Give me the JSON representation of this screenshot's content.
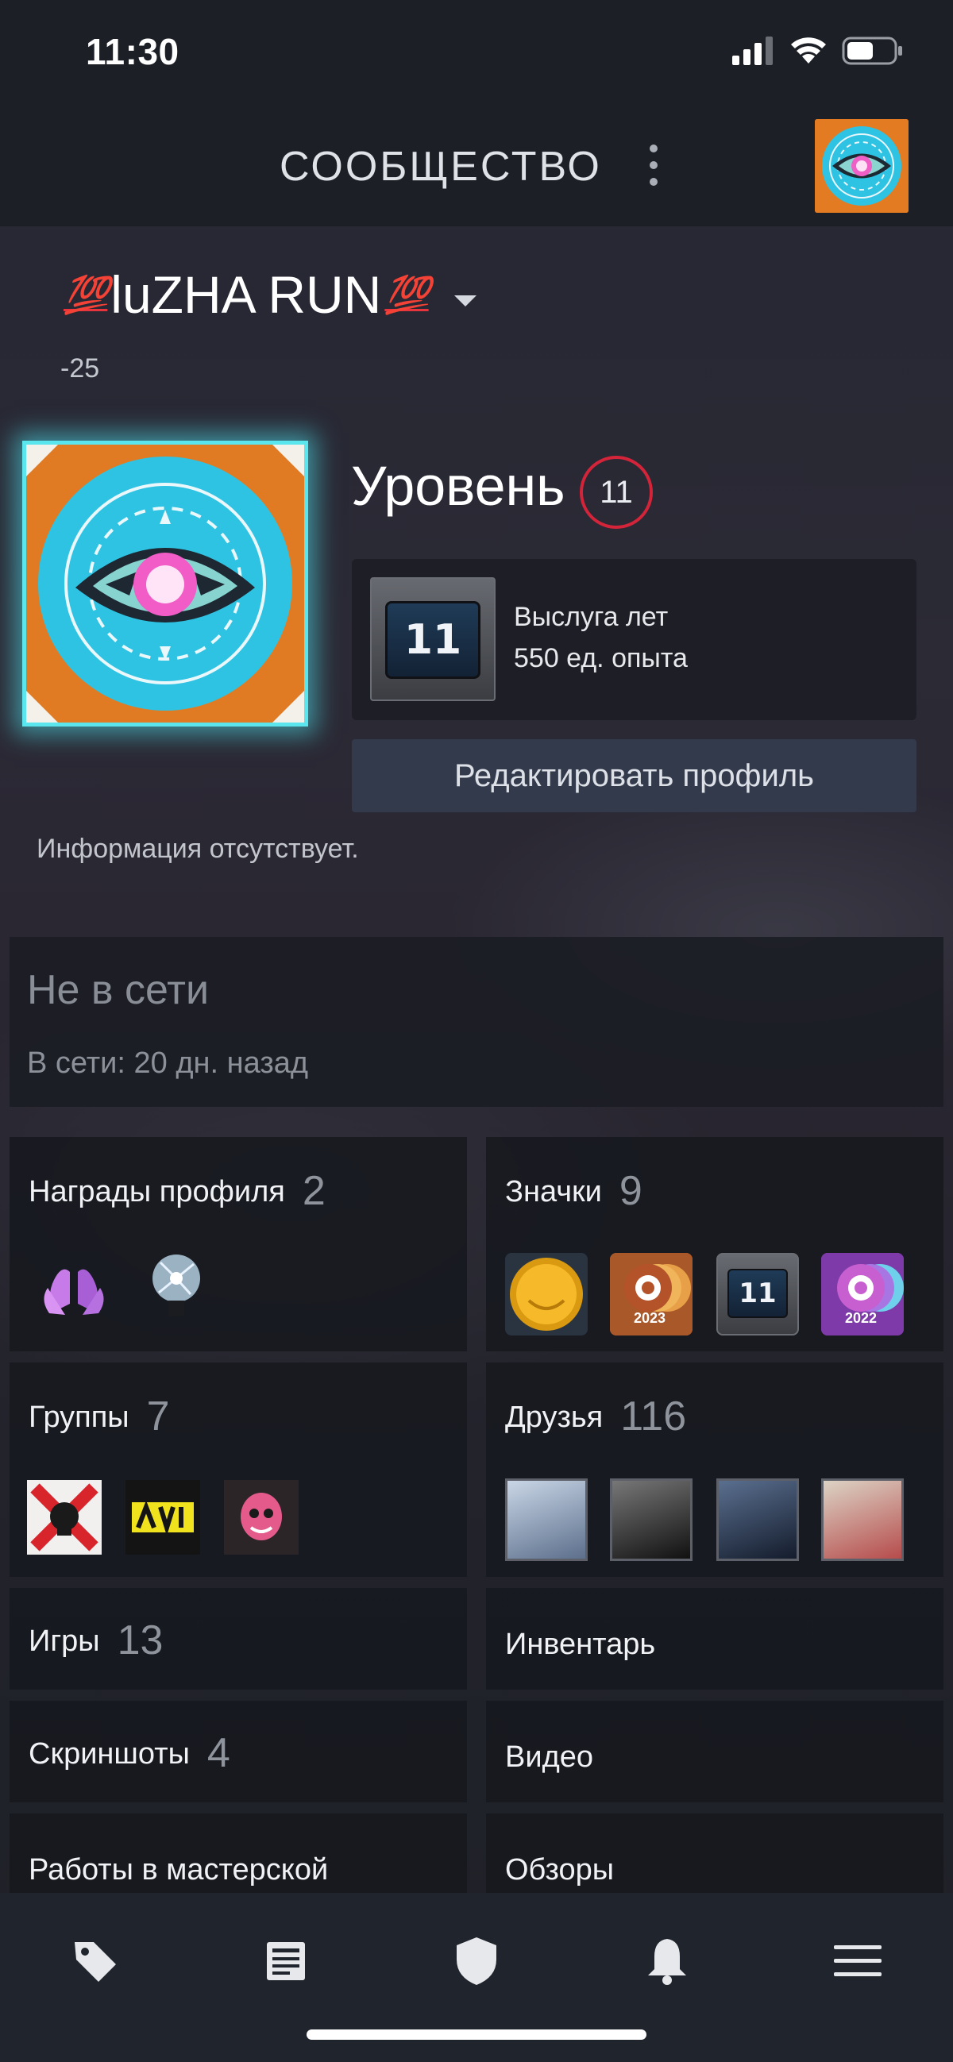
{
  "status_bar": {
    "time": "11:30",
    "icons": [
      "signal-icon",
      "wifi-icon",
      "battery-icon"
    ]
  },
  "header": {
    "title": "СООБЩЕСТВО",
    "menu_icon": "kebab-menu-icon"
  },
  "profile": {
    "name": "luZHA RUN",
    "name_decoration": "💯",
    "sub": "-25",
    "level_label": "Уровень",
    "level": "11",
    "xp_badge_number": "11",
    "xp_title": "Выслуга лет",
    "xp_sub": "550 ед. опыта",
    "edit_button": "Редактировать профиль",
    "info": "Информация отсутствует."
  },
  "status": {
    "title": "Не в сети",
    "sub": "В сети: 20 дн. назад"
  },
  "sections": {
    "awards": {
      "label": "Награды профиля",
      "count": "2"
    },
    "badges": {
      "label": "Значки",
      "count": "9",
      "badge_years": [
        "2023",
        "2022"
      ],
      "badge_number": "11"
    },
    "groups": {
      "label": "Группы",
      "count": "7"
    },
    "friends": {
      "label": "Друзья",
      "count": "116"
    },
    "games": {
      "label": "Игры",
      "count": "13"
    },
    "inventory": {
      "label": "Инвентарь"
    },
    "screenshots": {
      "label": "Скриншоты",
      "count": "4"
    },
    "videos": {
      "label": "Видео"
    },
    "workshop": {
      "label": "Работы в мастерской"
    },
    "reviews": {
      "label": "Обзоры"
    }
  },
  "bottom_nav": [
    "tag-icon",
    "news-icon",
    "shield-icon",
    "bell-icon",
    "hamburger-menu-icon"
  ],
  "colors": {
    "accent_red": "#d3243a",
    "button_bg": "#323a4c",
    "avatar_orange": "#e07b23",
    "avatar_cyan": "#2fc3e3"
  }
}
